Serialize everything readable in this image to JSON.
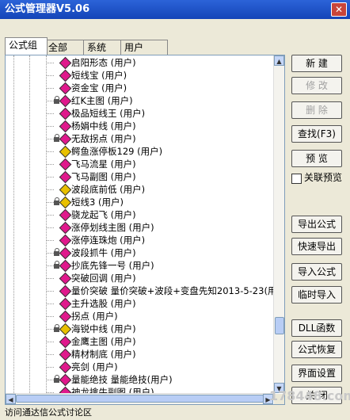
{
  "window": {
    "title": "公式管理器V5.06"
  },
  "tabs": [
    "公式组",
    "全部",
    "系统",
    "用户"
  ],
  "tree": [
    {
      "lock": false,
      "color": "magenta",
      "label": "启阳形态  (用户)"
    },
    {
      "lock": false,
      "color": "magenta",
      "label": "短线宝  (用户)"
    },
    {
      "lock": false,
      "color": "magenta",
      "label": "资金宝  (用户)"
    },
    {
      "lock": true,
      "color": "magenta",
      "label": "红K主图  (用户)"
    },
    {
      "lock": false,
      "color": "magenta",
      "label": "极品短线王  (用户)"
    },
    {
      "lock": false,
      "color": "magenta",
      "label": "杨娟中线  (用户)"
    },
    {
      "lock": true,
      "color": "magenta",
      "label": "无敌拐点  (用户)"
    },
    {
      "lock": false,
      "color": "yellow",
      "label": "鳄鱼涨停板129  (用户)"
    },
    {
      "lock": false,
      "color": "magenta",
      "label": "飞马流星  (用户)"
    },
    {
      "lock": false,
      "color": "magenta",
      "label": "飞马副图  (用户)"
    },
    {
      "lock": false,
      "color": "yellow",
      "label": "波段底前低  (用户)"
    },
    {
      "lock": true,
      "color": "yellow",
      "label": "短线3  (用户)"
    },
    {
      "lock": false,
      "color": "magenta",
      "label": "骁龙起飞  (用户)"
    },
    {
      "lock": false,
      "color": "magenta",
      "label": "涨停划线主图  (用户)"
    },
    {
      "lock": false,
      "color": "magenta",
      "label": "涨停连珠炮  (用户)"
    },
    {
      "lock": true,
      "color": "magenta",
      "label": "波段抓牛  (用户)"
    },
    {
      "lock": true,
      "color": "magenta",
      "label": "抄底先锋一号  (用户)"
    },
    {
      "lock": false,
      "color": "magenta",
      "label": "突破回调  (用户)"
    },
    {
      "lock": false,
      "color": "magenta",
      "label": "量价突破  量价突破+波段+变盘先知2013-5-23(用"
    },
    {
      "lock": false,
      "color": "magenta",
      "label": "主升选股  (用户)"
    },
    {
      "lock": false,
      "color": "magenta",
      "label": "拐点  (用户)"
    },
    {
      "lock": true,
      "color": "yellow",
      "label": "海锐中线  (用户)"
    },
    {
      "lock": false,
      "color": "magenta",
      "label": "金鹰主图  (用户)"
    },
    {
      "lock": false,
      "color": "magenta",
      "label": "精材制底  (用户)"
    },
    {
      "lock": false,
      "color": "magenta",
      "label": "亮剑  (用户)"
    },
    {
      "lock": true,
      "color": "magenta",
      "label": "量能绝技  量能绝技(用户)"
    },
    {
      "lock": false,
      "color": "magenta",
      "label": "神龙擒牛副图  (用户)"
    }
  ],
  "buttons": {
    "new": "新 建",
    "modify": "修 改",
    "delete": "删 除",
    "find": "查找(F3)",
    "preview": "预 览",
    "link_preview": "关联预览",
    "export": "导出公式",
    "quick_export": "快速导出",
    "import": "导入公式",
    "temp_import": "临时导入",
    "dll": "DLL函数",
    "restore": "公式恢复",
    "ui_settings": "界面设置",
    "close": "关 闭"
  },
  "status": "访问通达信公式讨论区",
  "watermark": "178448.com",
  "icons": {
    "close": "close-icon",
    "lock": "lock-icon",
    "formula": "formula-diamond-icon"
  },
  "colors": {
    "magenta": "#e0188c",
    "yellow": "#e8c000",
    "title": "#1c4fc8"
  }
}
